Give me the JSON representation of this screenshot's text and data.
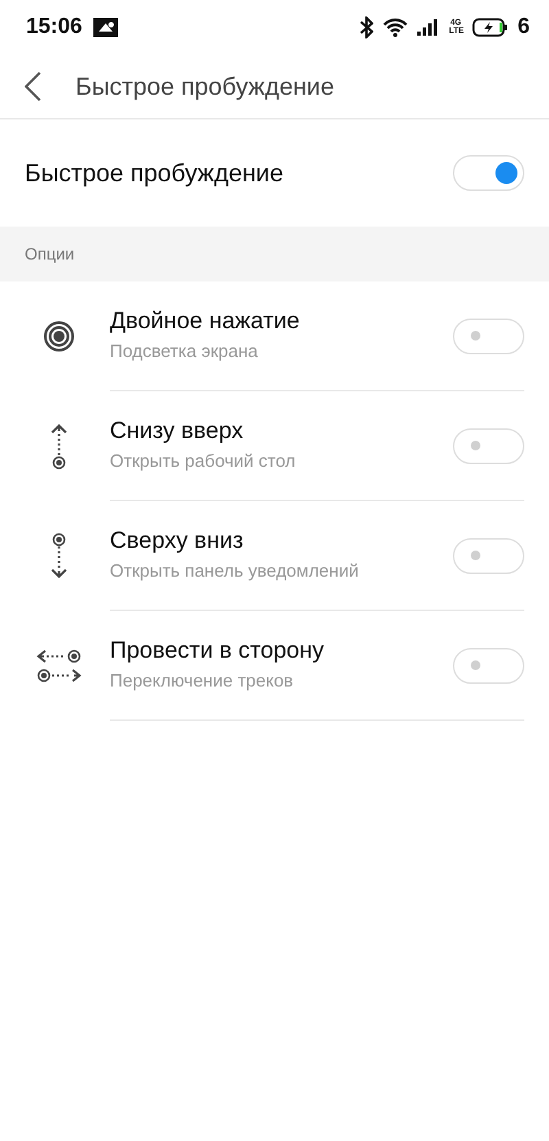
{
  "status_bar": {
    "time": "15:06",
    "network_type": "4G LTE",
    "battery": "6"
  },
  "header": {
    "title": "Быстрое пробуждение"
  },
  "main_setting": {
    "label": "Быстрое пробуждение",
    "on": true
  },
  "section": {
    "title": "Опции"
  },
  "options": [
    {
      "kind": "double_tap",
      "title": "Двойное нажатие",
      "subtitle": "Подсветка экрана",
      "on": false
    },
    {
      "kind": "swipe_up",
      "title": "Снизу вверх",
      "subtitle": "Открыть рабочий стол",
      "on": false
    },
    {
      "kind": "swipe_down",
      "title": "Сверху вниз",
      "subtitle": "Открыть панель уведомлений",
      "on": false
    },
    {
      "kind": "swipe_side",
      "title": "Провести в сторону",
      "subtitle": "Переключение треков",
      "on": false
    }
  ]
}
